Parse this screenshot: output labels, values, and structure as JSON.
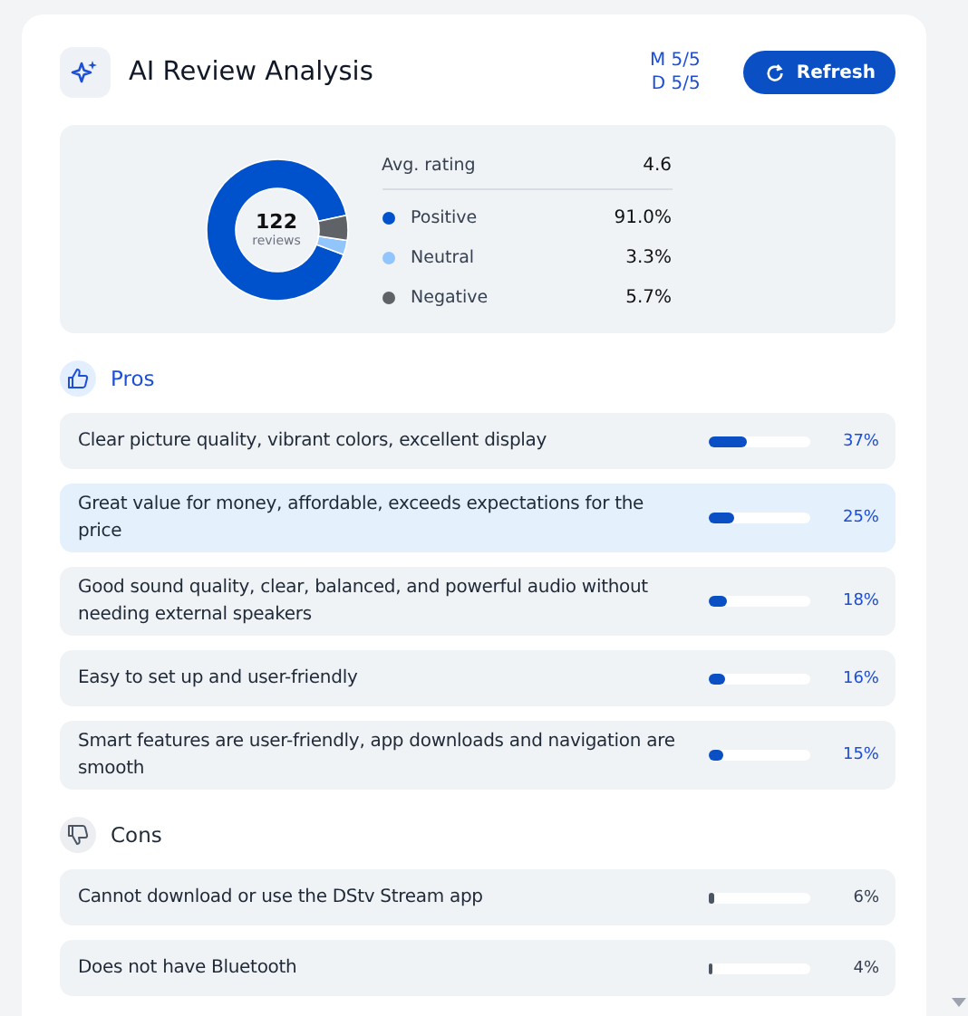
{
  "header": {
    "title": "AI Review Analysis",
    "quota": [
      "M 5/5",
      "D 5/5"
    ],
    "refresh_button": "Refresh"
  },
  "summary": {
    "total": "122",
    "total_label": "reviews",
    "avg_label": "Avg. rating",
    "avg_value": "4.6",
    "chart_data": {
      "type": "donut",
      "categories": [
        "Positive",
        "Neutral",
        "Negative"
      ],
      "values": [
        91.0,
        3.3,
        5.7
      ]
    },
    "legend": [
      {
        "value": "91.0%",
        "color": "#0052cc"
      },
      {
        "value": "3.3%",
        "color": "#93c5fd"
      },
      {
        "value": "5.7%",
        "color": "#5f6368"
      }
    ]
  },
  "sections": [
    {
      "kind": "pros",
      "title": "Pros",
      "items": [
        {
          "text": "Clear picture quality, vibrant colors, excellent display",
          "level": 0.37,
          "percent": "37%",
          "selected": false
        },
        {
          "text": "Great value for money, affordable, exceeds expectations for the price",
          "level": 0.25,
          "percent": "25%",
          "selected": true
        },
        {
          "text": "Good sound quality, clear, balanced, and powerful audio without needing external speakers",
          "level": 0.18,
          "percent": "18%",
          "selected": false
        },
        {
          "text": "Easy to set up and user-friendly",
          "level": 0.16,
          "percent": "16%",
          "selected": false
        },
        {
          "text": "Smart features are user-friendly, app downloads and navigation are smooth",
          "level": 0.15,
          "percent": "15%",
          "selected": false
        }
      ]
    },
    {
      "kind": "cons",
      "title": "Cons",
      "items": [
        {
          "text": "Cannot download or use the DStv Stream app",
          "level": 0.06,
          "percent": "6%",
          "selected": false
        },
        {
          "text": "Does not have Bluetooth",
          "level": 0.04,
          "percent": "4%",
          "selected": false
        }
      ]
    }
  ]
}
